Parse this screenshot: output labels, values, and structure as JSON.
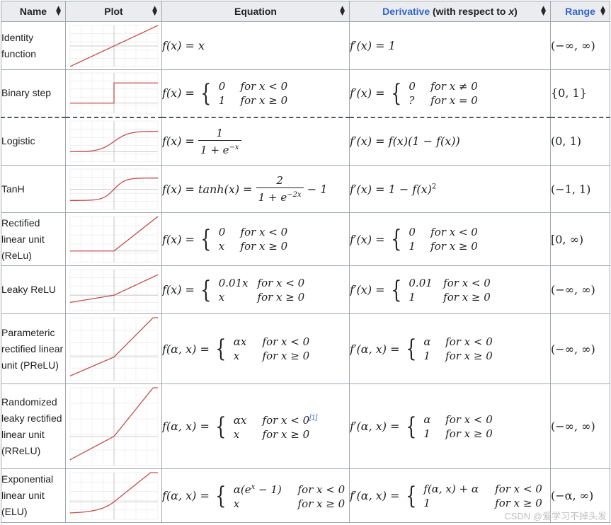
{
  "headers": {
    "name": "Name",
    "plot": "Plot",
    "equation": "Equation",
    "derivative_link": "Derivative",
    "derivative_rest": " (with respect to ",
    "derivative_var": "x",
    "derivative_close": ")",
    "range": "Range"
  },
  "rows": [
    {
      "name": "Identity function",
      "eq_lhs": "f(x) = x",
      "der_lhs": "f′(x) = 1",
      "range": "(−∞, ∞)"
    },
    {
      "name": "Binary step",
      "eq_lhs": "f(x) =",
      "eq_c1v": "0",
      "eq_c1c": "for x < 0",
      "eq_c2v": "1",
      "eq_c2c": "for x ≥ 0",
      "der_lhs": "f′(x) =",
      "der_c1v": "0",
      "der_c1c": "for x ≠ 0",
      "der_c2v": "?",
      "der_c2c": "for x = 0",
      "range": "{0, 1}"
    },
    {
      "name": "Logistic",
      "eq_lhs": "f(x) =",
      "eq_num": "1",
      "eq_den": "1 + e",
      "eq_den_sup": "−x",
      "der_lhs": "f′(x) = f(x)(1 − f(x))",
      "range": "(0, 1)"
    },
    {
      "name": "TanH",
      "eq_lhs": "f(x) = tanh(x) =",
      "eq_num": "2",
      "eq_den": "1 + e",
      "eq_den_sup": "−2x",
      "eq_tail": "− 1",
      "der_lhs": "f′(x) = 1 − f(x)",
      "der_sup": "2",
      "range": "(−1, 1)"
    },
    {
      "name": "Rectified linear unit (ReLu)",
      "eq_lhs": "f(x) =",
      "eq_c1v": "0",
      "eq_c1c": "for x < 0",
      "eq_c2v": "x",
      "eq_c2c": "for x ≥ 0",
      "der_lhs": "f′(x) =",
      "der_c1v": "0",
      "der_c1c": "for x < 0",
      "der_c2v": "1",
      "der_c2c": "for x ≥ 0",
      "range": "[0, ∞)"
    },
    {
      "name": "Leaky ReLU",
      "eq_lhs": "f(x) =",
      "eq_c1v": "0.01x",
      "eq_c1c": "for x < 0",
      "eq_c2v": "x",
      "eq_c2c": "for x ≥ 0",
      "der_lhs": "f′(x) =",
      "der_c1v": "0.01",
      "der_c1c": "for x < 0",
      "der_c2v": "1",
      "der_c2c": "for x ≥ 0",
      "range": "(−∞, ∞)"
    },
    {
      "name": "Parameteric rectified linear unit (PReLU)",
      "eq_lhs": "f(α, x) =",
      "eq_c1v": "αx",
      "eq_c1c": "for x < 0",
      "eq_c2v": "x",
      "eq_c2c": "for x ≥ 0",
      "der_lhs": "f′(α, x) =",
      "der_c1v": "α",
      "der_c1c": "for x < 0",
      "der_c2v": "1",
      "der_c2c": "for x ≥ 0",
      "range": "(−∞, ∞)"
    },
    {
      "name": "Randomized leaky rectified linear unit (RReLU)",
      "eq_lhs": "f(α, x) =",
      "eq_c1v": "αx",
      "eq_c1c": "for x < 0",
      "eq_c2v": "x",
      "eq_c2c": "for x ≥ 0",
      "eq_cite": "[1]",
      "der_lhs": "f′(α, x) =",
      "der_c1v": "α",
      "der_c1c": "for x < 0",
      "der_c2v": "1",
      "der_c2c": "for x ≥ 0",
      "range": "(−∞, ∞)"
    },
    {
      "name": "Exponential linear unit (ELU)",
      "eq_lhs": "f(α, x) =",
      "eq_c1v": "α(e",
      "eq_c1v_sup": "x",
      "eq_c1v_tail": " − 1)",
      "eq_c1c": "for x < 0",
      "eq_c2v": "x",
      "eq_c2c": "for x ≥ 0",
      "der_lhs": "f′(α, x) =",
      "der_c1v": "f(α, x) + α",
      "der_c1c": "for x < 0",
      "der_c2v": "1",
      "der_c2c": "for x ≥ 0",
      "range": "(−α, ∞)"
    }
  ],
  "colors": {
    "curve": "#c0504d",
    "grid": "#e6e6e6",
    "header_bg": "#eaecf0",
    "link": "#3366cc"
  },
  "watermark": "CSDN @爱学习不掉头发"
}
